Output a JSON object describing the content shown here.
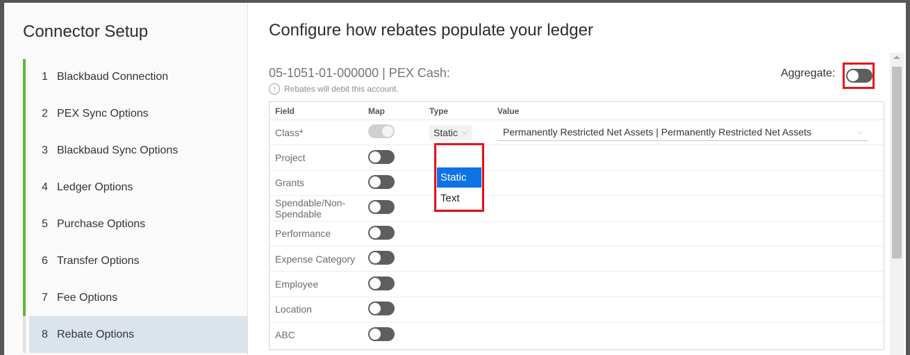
{
  "sidebar": {
    "title": "Connector Setup",
    "steps": [
      {
        "num": "1",
        "label": "Blackbaud Connection"
      },
      {
        "num": "2",
        "label": "PEX Sync Options"
      },
      {
        "num": "3",
        "label": "Blackbaud Sync Options"
      },
      {
        "num": "4",
        "label": "Ledger Options"
      },
      {
        "num": "5",
        "label": "Purchase Options"
      },
      {
        "num": "6",
        "label": "Transfer Options"
      },
      {
        "num": "7",
        "label": "Fee Options"
      },
      {
        "num": "8",
        "label": "Rebate Options"
      }
    ],
    "active_step": 8
  },
  "main": {
    "title": "Configure how rebates populate your ledger",
    "account": "05-1051-01-000000 | PEX Cash:",
    "hint": "Rebates will debit this account.",
    "aggregate_label": "Aggregate:",
    "aggregate_on": false
  },
  "table": {
    "headers": {
      "field": "Field",
      "map": "Map",
      "type": "Type",
      "value": "Value"
    },
    "rows": [
      {
        "field": "Class*",
        "mapped": true,
        "type": "Static",
        "value": "Permanently Restricted Net Assets | Permanently Restricted Net Assets"
      },
      {
        "field": "Project",
        "mapped": false
      },
      {
        "field": "Grants",
        "mapped": false
      },
      {
        "field": "Spendable/Non-Spendable",
        "mapped": false
      },
      {
        "field": "Performance",
        "mapped": false
      },
      {
        "field": "Expense Category",
        "mapped": false
      },
      {
        "field": "Employee",
        "mapped": false
      },
      {
        "field": "Location",
        "mapped": false
      },
      {
        "field": "ABC",
        "mapped": false
      }
    ]
  },
  "type_dropdown": {
    "options": [
      "",
      "Static",
      "Text"
    ],
    "selected": "Static"
  },
  "icons": {
    "hint": "arrow-up-circle-icon",
    "chevron": "chevron-down-icon"
  },
  "colors": {
    "accent_green": "#5fb734",
    "highlight_red": "#e8141b",
    "selected_blue": "#0f72e5",
    "active_step_bg": "#dbe4ec"
  }
}
